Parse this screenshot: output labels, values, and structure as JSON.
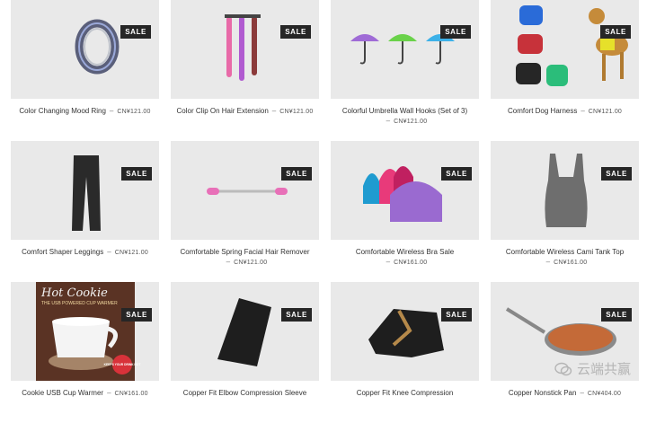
{
  "badge_label": "SALE",
  "products": [
    {
      "title": "Color Changing Mood Ring",
      "price": "CN¥121.00",
      "icon": "ring-icon"
    },
    {
      "title": "Color Clip On Hair Extension",
      "price": "CN¥121.00",
      "icon": "hair-extension-icon"
    },
    {
      "title": "Colorful Umbrella Wall Hooks (Set of 3)",
      "price": "CN¥121.00",
      "icon": "umbrella-hooks-icon"
    },
    {
      "title": "Comfort Dog Harness",
      "price": "CN¥121.00",
      "icon": "dog-harness-icon"
    },
    {
      "title": "Comfort Shaper Leggings",
      "price": "CN¥121.00",
      "icon": "leggings-icon"
    },
    {
      "title": "Comfortable Spring Facial Hair Remover",
      "price": "CN¥121.00",
      "icon": "hair-remover-icon"
    },
    {
      "title": "Comfortable Wireless Bra Sale",
      "price": "CN¥161.00",
      "icon": "bra-icon"
    },
    {
      "title": "Comfortable Wireless Cami Tank Top",
      "price": "CN¥161.00",
      "icon": "tank-top-icon"
    },
    {
      "title": "Cookie USB Cup Warmer",
      "price": "CN¥161.00",
      "icon": "cup-warmer-icon",
      "box_title": "Hot Cookie",
      "box_subtitle": "THE USB POWERED CUP WARMER",
      "box_tag": "KEEPS YOUR DRINK HOT"
    },
    {
      "title": "Copper Fit Elbow Compression Sleeve",
      "price": "",
      "icon": "elbow-sleeve-icon"
    },
    {
      "title": "Copper Fit Knee Compression",
      "price": "",
      "icon": "knee-sleeve-icon"
    },
    {
      "title": "Copper Nonstick Pan",
      "price": "CN¥404.00",
      "icon": "pan-icon"
    }
  ],
  "watermark": {
    "text": "云端共赢",
    "icon": "wechat-icon"
  }
}
